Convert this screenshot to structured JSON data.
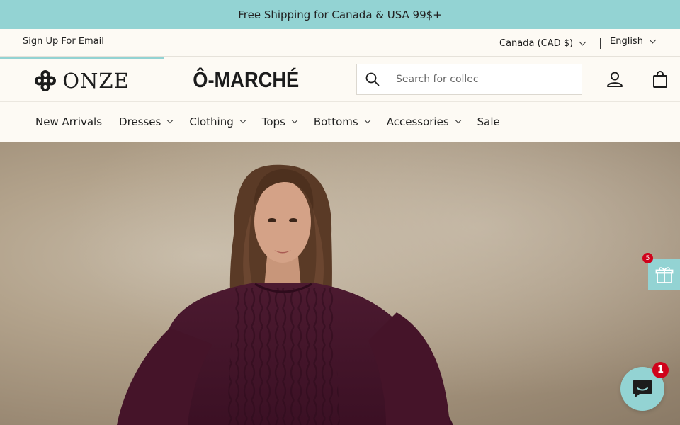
{
  "announcement": {
    "text": "Free Shipping for Canada & USA 99$+"
  },
  "utility": {
    "signup_label": "Sign Up For Email",
    "currency_label": "Canada (CAD $)",
    "separator": "|",
    "language_label": "English"
  },
  "header": {
    "stores": [
      {
        "label": "ONZE",
        "icon": "clover-logo-icon"
      },
      {
        "label": "Ô-MARCHÉ"
      }
    ],
    "search": {
      "placeholder": "Search for collec",
      "value": ""
    }
  },
  "nav": {
    "items": [
      {
        "label": "New Arrivals"
      },
      {
        "label": "Dresses"
      },
      {
        "label": "Clothing"
      },
      {
        "label": "Tops"
      },
      {
        "label": "Bottoms"
      },
      {
        "label": "Accessories"
      },
      {
        "label": "Sale"
      }
    ]
  },
  "widgets": {
    "gift_badge": "5",
    "chat_badge": "1"
  },
  "colors": {
    "accent": "#93d3d3",
    "badge": "#d0021b",
    "background": "#fdfaf4"
  }
}
